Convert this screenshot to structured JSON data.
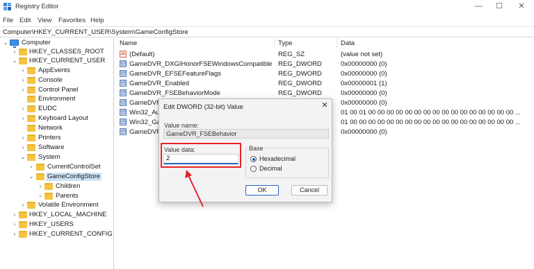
{
  "window": {
    "title": "Registry Editor",
    "controls": {
      "minimize": "—",
      "maximize": "☐",
      "close": "✕"
    }
  },
  "menu": [
    "File",
    "Edit",
    "View",
    "Favorites",
    "Help"
  ],
  "address": "Computer\\HKEY_CURRENT_USER\\System\\GameConfigStore",
  "tree": {
    "root": "Computer",
    "hkcr": "HKEY_CLASSES_ROOT",
    "hkcu": "HKEY_CURRENT_USER",
    "hkcu_children": [
      "AppEvents",
      "Console",
      "Control Panel",
      "Environment",
      "EUDC",
      "Keyboard Layout",
      "Network",
      "Printers",
      "Software",
      "System"
    ],
    "system_children": [
      "CurrentControlSet",
      "GameConfigStore"
    ],
    "gcs_children": [
      "Children",
      "Parents"
    ],
    "volatile": "Volatile Environment",
    "hklm": "HKEY_LOCAL_MACHINE",
    "hku": "HKEY_USERS",
    "hkcc": "HKEY_CURRENT_CONFIG"
  },
  "list": {
    "headers": {
      "name": "Name",
      "type": "Type",
      "data": "Data"
    },
    "rows": [
      {
        "name": "(Default)",
        "type": "REG_SZ",
        "data": "(value not set)",
        "icon": "string-value-icon"
      },
      {
        "name": "GameDVR_DXGIHonorFSEWindowsCompatible",
        "type": "REG_DWORD",
        "data": "0x00000000 (0)",
        "icon": "binary-value-icon"
      },
      {
        "name": "GameDVR_EFSEFeatureFlags",
        "type": "REG_DWORD",
        "data": "0x00000000 (0)",
        "icon": "binary-value-icon"
      },
      {
        "name": "GameDVR_Enabled",
        "type": "REG_DWORD",
        "data": "0x00000001 (1)",
        "icon": "binary-value-icon"
      },
      {
        "name": "GameDVR_FSEBehaviorMode",
        "type": "REG_DWORD",
        "data": "0x00000000 (0)",
        "icon": "binary-value-icon"
      },
      {
        "name": "GameDVR",
        "type": "",
        "data": "0x00000000 (0)",
        "icon": "binary-value-icon"
      },
      {
        "name": "Win32_Au",
        "type": "",
        "data": "01 00 01 00 00 00 00 00 00 00 00 00 00 00 00 00 00 00 00 ...",
        "icon": "binary-value-icon"
      },
      {
        "name": "Win32_Ga",
        "type": "",
        "data": "01 00 00 00 00 00 00 00 00 00 00 00 00 00 00 00 00 00 00 ...",
        "icon": "binary-value-icon"
      },
      {
        "name": "GameDVR",
        "type": "",
        "data": "0x00000000 (0)",
        "icon": "binary-value-icon"
      }
    ]
  },
  "dialog": {
    "title": "Edit DWORD (32-bit) Value",
    "close": "✕",
    "value_name_label": "Value name:",
    "value_name": "GameDVR_FSEBehavior",
    "value_data_label": "Value data:",
    "value_data": "2",
    "base_label": "Base",
    "hex_label": "Hexadecimal",
    "dec_label": "Decimal",
    "ok_label": "OK",
    "cancel_label": "Cancel"
  },
  "colors": {
    "highlight": "#e8232a",
    "selection": "#cce4f7",
    "accent": "#2a65c4",
    "folder": "#f5c443"
  }
}
